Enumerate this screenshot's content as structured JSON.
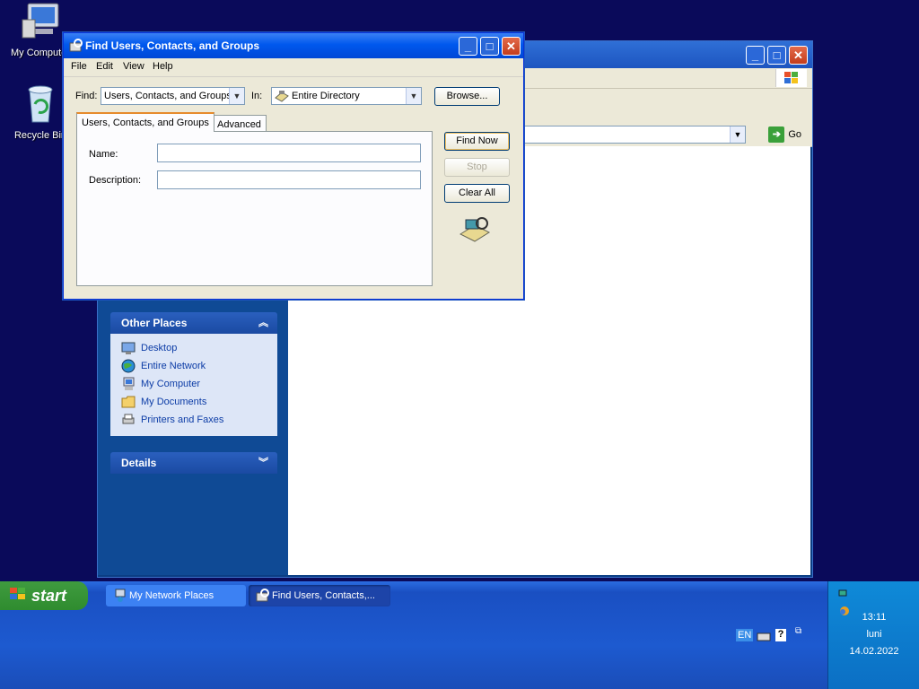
{
  "desktop": {
    "icons": [
      {
        "label": "My Computer",
        "icon": "my-computer-icon"
      },
      {
        "label": "Recycle Bin",
        "icon": "recycle-bin-icon"
      }
    ]
  },
  "explorer": {
    "address_go": "Go",
    "other_places": {
      "title": "Other Places",
      "items": [
        {
          "label": "Desktop",
          "icon": "desktop-icon"
        },
        {
          "label": "Entire Network",
          "icon": "network-globe-icon"
        },
        {
          "label": "My Computer",
          "icon": "my-computer-icon"
        },
        {
          "label": "My Documents",
          "icon": "my-documents-icon"
        },
        {
          "label": "Printers and Faxes",
          "icon": "printer-icon"
        }
      ]
    },
    "details": {
      "title": "Details"
    }
  },
  "dialog": {
    "title": "Find Users, Contacts, and Groups",
    "menu": [
      "File",
      "Edit",
      "View",
      "Help"
    ],
    "find_label": "Find:",
    "find_value": "Users, Contacts, and Groups",
    "in_label": "In:",
    "in_value": "Entire Directory",
    "browse": "Browse...",
    "tabs": [
      "Users, Contacts, and Groups",
      "Advanced"
    ],
    "name_label": "Name:",
    "description_label": "Description:",
    "name_value": "",
    "description_value": "",
    "find_now": "Find Now",
    "stop": "Stop",
    "clear_all": "Clear All"
  },
  "taskbar": {
    "start": "start",
    "buttons": [
      {
        "label": "My Network Places",
        "icon": "network-places-icon"
      },
      {
        "label": "Find Users, Contacts,...",
        "icon": "find-users-icon"
      }
    ],
    "tray": {
      "lang": "EN",
      "time": "13:11",
      "day": "luni",
      "date": "14.02.2022"
    }
  }
}
